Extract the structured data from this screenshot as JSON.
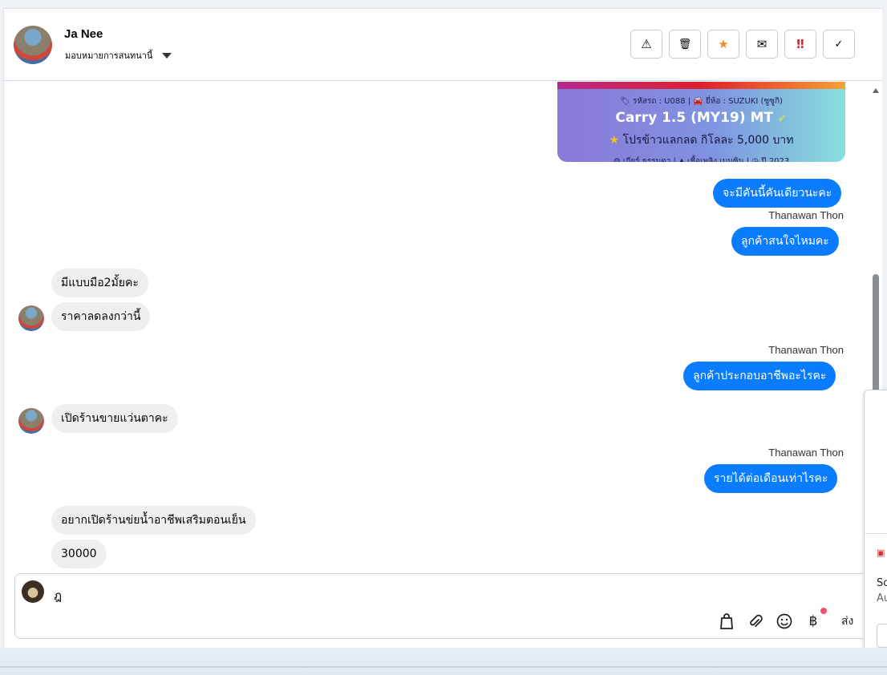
{
  "header": {
    "name": "Ja Nee",
    "assign_label": "มอบหมายการสนทนานี้",
    "actions": [
      {
        "icon": "warning-icon",
        "glyph": "⚠"
      },
      {
        "icon": "trash-icon",
        "glyph": "🗑"
      },
      {
        "icon": "star-icon",
        "glyph": "★"
      },
      {
        "icon": "mail-icon",
        "glyph": "✉"
      },
      {
        "icon": "important-icon",
        "glyph": "‼"
      },
      {
        "icon": "check-icon",
        "glyph": "✓"
      }
    ]
  },
  "card": {
    "code_line": "🏷 รหัสรถ : U088 | 🚘 ยี่ห้อ : SUZUKI (ซูซูกิ)",
    "model": "Carry 1.5 (MY19) MT",
    "promo": "โปรข้าวแลกลด กิโลละ 5,000 บาท",
    "footer": "⚙ เกียร์ ธรรมดา  |  ▲ เชื้อเพลิง เบนซิน  |  ◷ ปี 2023"
  },
  "messages": {
    "out1": "จะมีคันนี้คันเดียวนะคะ",
    "sender": "Thanawan Thon",
    "out2": "ลูกค้าสนใจไหมคะ",
    "in1": "มีแบบมือ2มั้ยคะ",
    "in2": "ราคาลดลงกว่านี้",
    "out3": "ลูกค้าประกอบอาชีพอะไรคะ",
    "in3": "เปิดร้านขายแว่นตาคะ",
    "out4": "รายได้ต่อเดือนเท่าไรคะ",
    "in4": "อยากเปิดร้านข่ยน้ำอาชีพเสริมตอนเย็น",
    "in5": "30000"
  },
  "composer": {
    "text": "ฎ",
    "send_label": "ส่ง",
    "tools": [
      "bag-icon",
      "paperclip-icon",
      "emoji-icon",
      "baht-icon"
    ]
  },
  "popup": {
    "line1": "Sc",
    "line2": "Au"
  }
}
